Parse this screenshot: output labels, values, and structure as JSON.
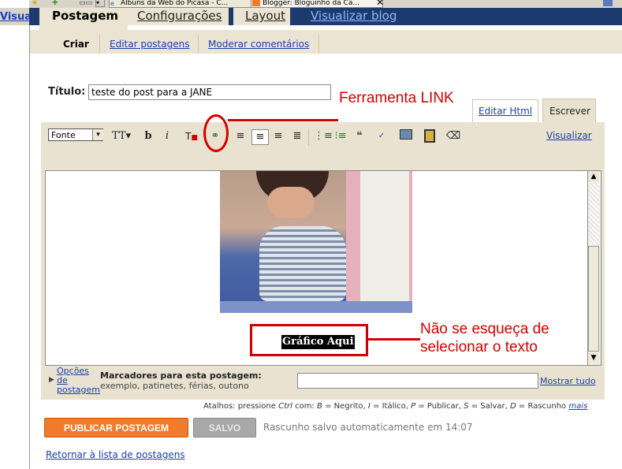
{
  "browser": {
    "tabs": [
      "Álbuns da Web do Picasa - C...",
      "Blogger: Bloguinho da Ca..."
    ],
    "left_partial_link": "Visuali"
  },
  "blogger": {
    "main_tabs": [
      "Postagem",
      "Configurações",
      "Layout"
    ],
    "view_blog": "Visualizar blog",
    "sub_tabs": [
      "Criar",
      "Editar postagens",
      "Moderar comentários"
    ]
  },
  "post": {
    "title_label": "Título:",
    "title_value": "teste do post para a JANE"
  },
  "editor": {
    "mode_tabs": [
      "Editar Html",
      "Escrever"
    ],
    "font_select": "Fonte",
    "preview_link": "Visualizar",
    "selected_text": "Gráfico Aqui"
  },
  "annotations": {
    "link_tool": "Ferramenta LINK",
    "select_text_line1": "Não se esqueça de",
    "select_text_line2": "selecionar o texto"
  },
  "options": {
    "line1": "Opções",
    "line2": "de",
    "line3": "postagem",
    "labels_title": "Marcadores para esta postagem:",
    "labels_example": "exemplo, patinetes, férias, outono",
    "show_all": "Mostrar tudo"
  },
  "shortcuts": {
    "prefix": "Atalhos: pressione",
    "ctrl": "Ctrl",
    "com": "com:",
    "b_key": "B",
    "b_label": "= Negrito,",
    "i_key": "I",
    "i_label": "= Itálico,",
    "p_key": "P",
    "p_label": "= Publicar,",
    "s_key": "S",
    "s_label": "= Salvar,",
    "d_key": "D",
    "d_label": "= Rascunho",
    "more": "mais"
  },
  "actions": {
    "publish": "PUBLICAR POSTAGEM",
    "saved": "SALVO",
    "autosave_status": "Rascunho salvo automaticamente em 14:07",
    "back_link": "Retornar à lista de postagens"
  },
  "colors": {
    "publish_button": "#f07b2a",
    "annotation_red": "#d40000",
    "link_blue": "#1a3fb0"
  }
}
